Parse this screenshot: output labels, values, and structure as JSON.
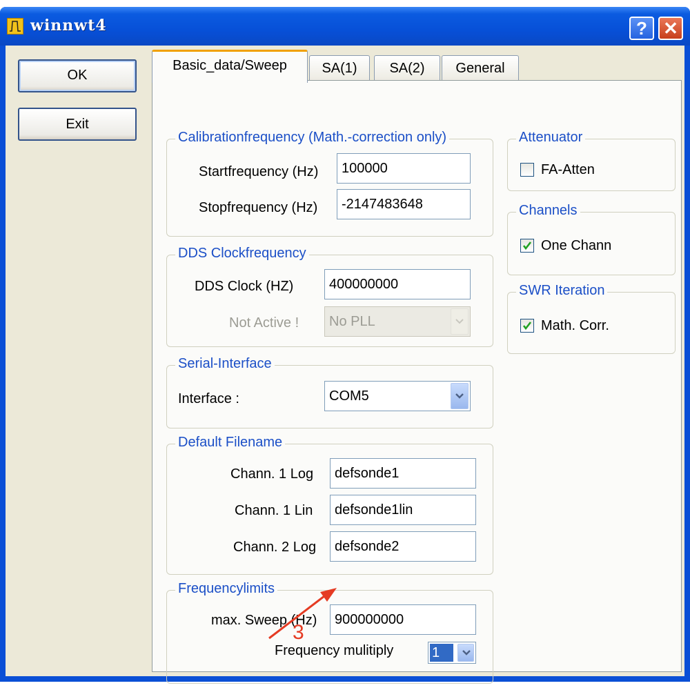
{
  "window": {
    "title": "winnwt4",
    "help_label": "?",
    "close_label": "✕"
  },
  "buttons": {
    "ok": "OK",
    "exit": "Exit"
  },
  "tabs": [
    {
      "label": "Basic_data/Sweep",
      "active": true
    },
    {
      "label": "SA(1)",
      "active": false
    },
    {
      "label": "SA(2)",
      "active": false
    },
    {
      "label": "General",
      "active": false
    }
  ],
  "calibration": {
    "legend": "Calibrationfrequency (Math.-correction only)",
    "start_label": "Startfrequency (Hz)",
    "start_value": "100000",
    "stop_label": "Stopfrequency (Hz)",
    "stop_value": "-2147483648"
  },
  "dds": {
    "legend": "DDS Clockfrequency",
    "clock_label": "DDS Clock (HZ)",
    "clock_value": "400000000",
    "pll_label": "Not Active !",
    "pll_value": "No PLL"
  },
  "serial": {
    "legend": "Serial-Interface",
    "interface_label": "Interface :",
    "interface_value": "COM5"
  },
  "filenames": {
    "legend": "Default Filename",
    "rows": [
      {
        "label": "Chann. 1  Log",
        "value": "defsonde1"
      },
      {
        "label": "Chann. 1  Lin",
        "value": "defsonde1lin"
      },
      {
        "label": "Chann. 2 Log",
        "value": "defsonde2"
      }
    ]
  },
  "limits": {
    "legend": "Frequencylimits",
    "max_sweep_label": "max. Sweep (Hz)",
    "max_sweep_value": "900000000",
    "multiply_label": "Frequency mulitiply",
    "multiply_value": "1"
  },
  "attenuator": {
    "legend": "Attenuator",
    "checkbox_label": "FA-Atten",
    "checked": false
  },
  "channels": {
    "legend": "Channels",
    "checkbox_label": "One Chann",
    "checked": true
  },
  "swr": {
    "legend": "SWR Iteration",
    "checkbox_label": "Math. Corr.",
    "checked": true
  },
  "annotation": {
    "number": "3",
    "color": "#e53b23"
  }
}
